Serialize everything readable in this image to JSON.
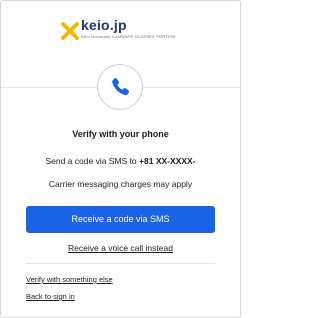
{
  "header": {
    "brand": "keio.jp",
    "brand_sub": "Keio University CAMBRER GLASSES PORTION",
    "logo_icon": "keio-x-logo-icon",
    "logo_color": "#f5b800"
  },
  "verify": {
    "icon": "phone-icon",
    "title": "Verify with your phone",
    "send_prefix": "Send a code via SMS to",
    "phone_number": "+81 XX-XXXX-",
    "carrier_note": "Carrier messaging charges may apply"
  },
  "actions": {
    "primary_label": "Receive a code via SMS",
    "voice_label": "Receive a voice call instead",
    "other_label": "Verify with something else",
    "back_label": "Back to sign in"
  },
  "colors": {
    "accent": "#1a62e6",
    "brand": "#1d3a78",
    "phone_icon": "#1a62e6"
  }
}
